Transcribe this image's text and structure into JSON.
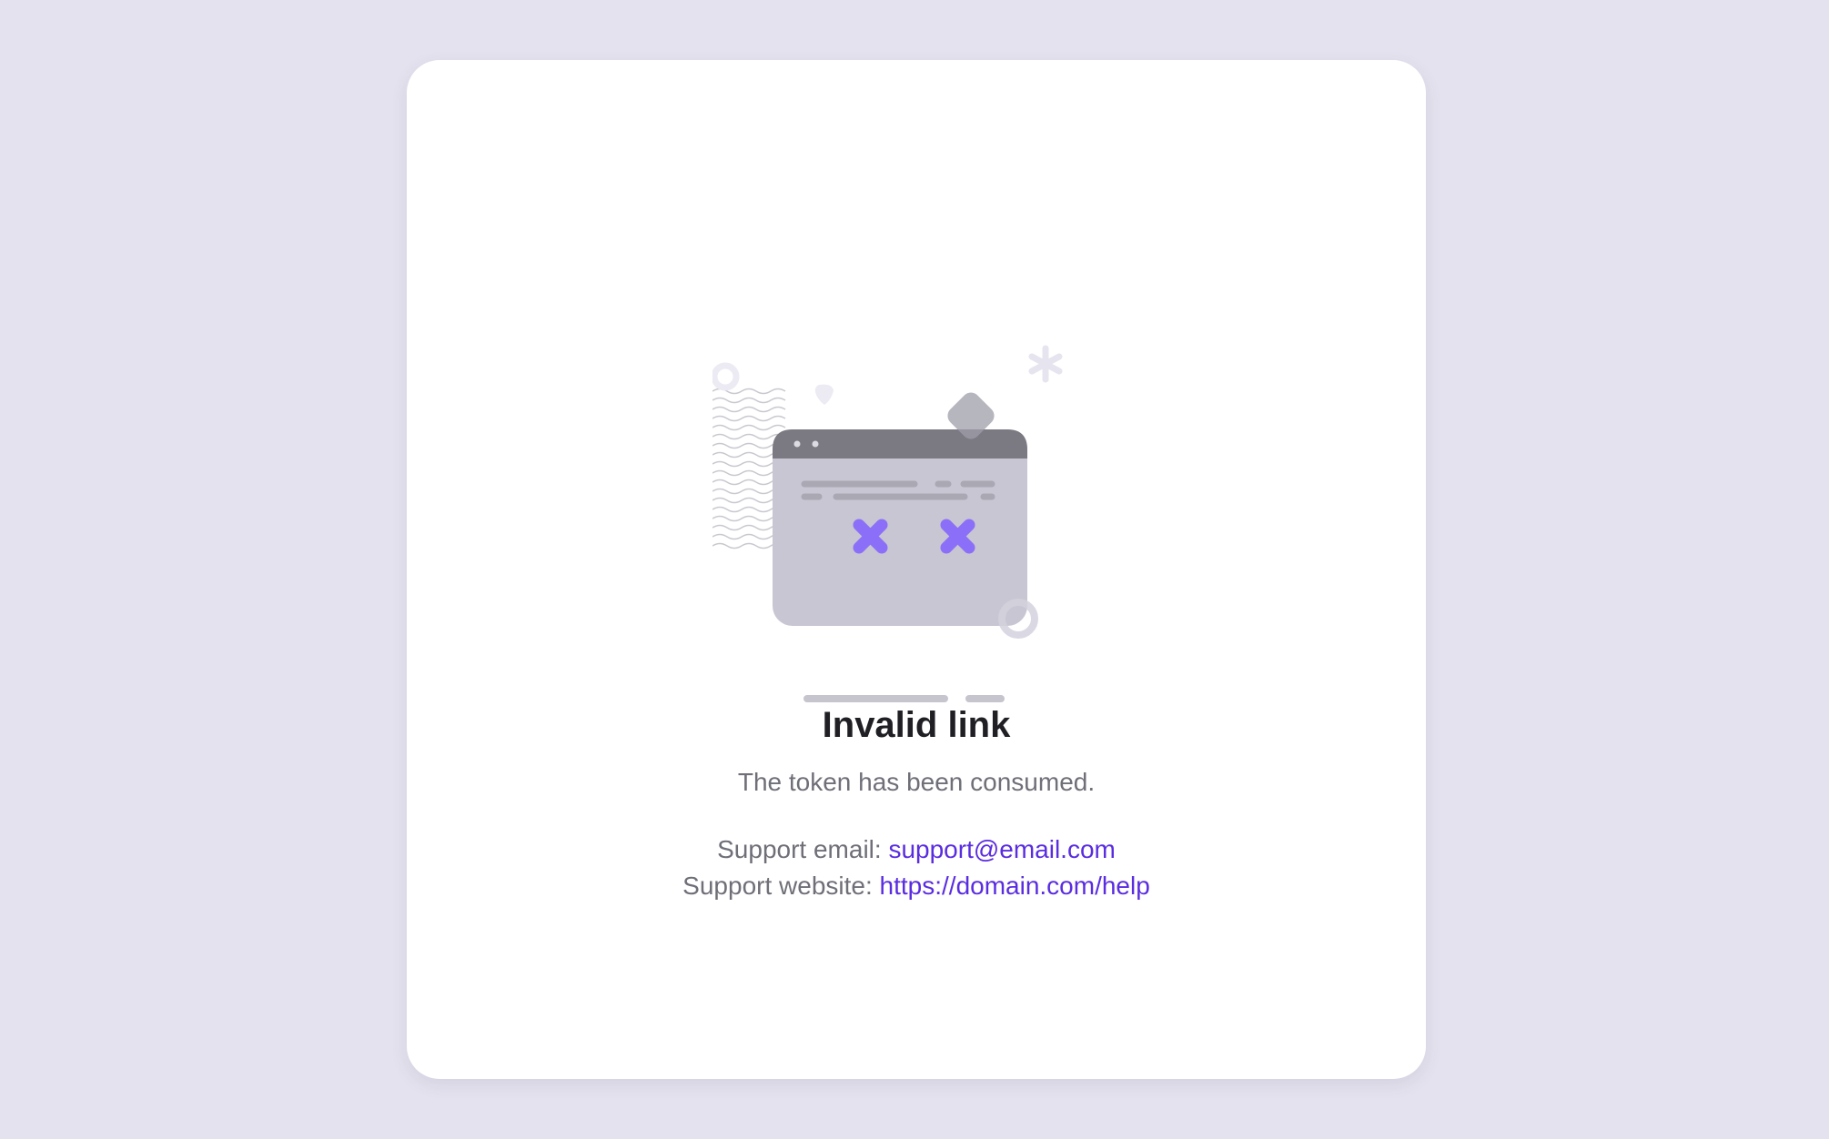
{
  "error": {
    "title": "Invalid link",
    "message": "The token has been consumed."
  },
  "support": {
    "email_label": "Support email:",
    "email_value": "support@email.com",
    "website_label": "Support website:",
    "website_value": "https://domain.com/help"
  },
  "illustration": {
    "icon": "broken-browser-window-icon"
  },
  "colors": {
    "background": "#e4e2ee",
    "card": "#ffffff",
    "accent": "#5a2de0",
    "x_marks": "#8c6ff8",
    "title": "#1f1f24",
    "muted_text": "#6f6f78"
  }
}
